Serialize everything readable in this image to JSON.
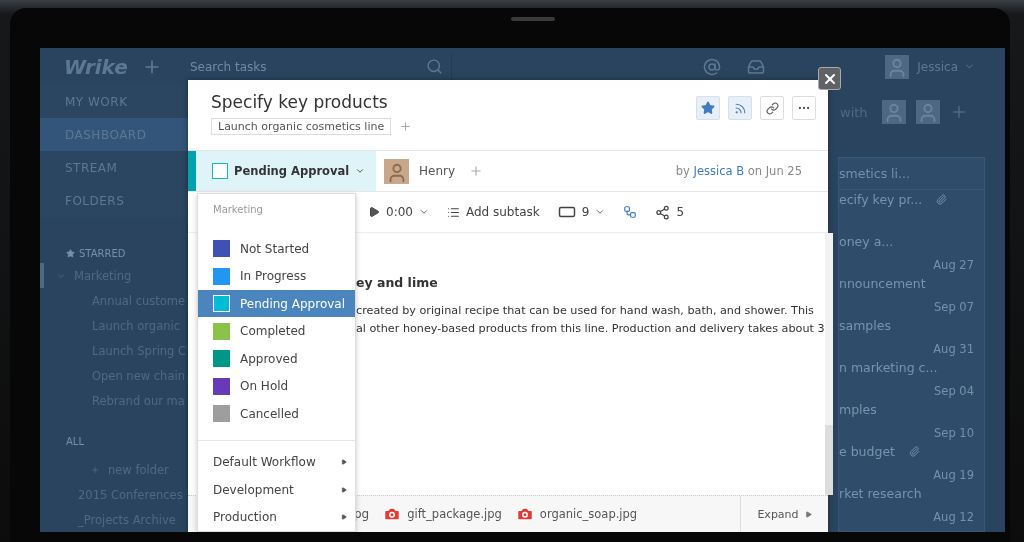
{
  "topbar": {
    "logo": "Wrike",
    "search": {
      "placeholder": "Search tasks"
    },
    "user": "Jessica"
  },
  "sidebar": {
    "nav": [
      {
        "label": "MY WORK",
        "selected": false
      },
      {
        "label": "DASHBOARD",
        "selected": true
      },
      {
        "label": "STREAM",
        "selected": false
      },
      {
        "label": "FOLDERS",
        "selected": false
      }
    ],
    "starred": {
      "label": "STARRED",
      "folder": {
        "label": "Marketing",
        "expanded": true,
        "children": [
          {
            "label": "Annual custome"
          },
          {
            "label": "Launch organic"
          },
          {
            "label": "Launch Spring C"
          },
          {
            "label": "Open new chain"
          },
          {
            "label": "Rebrand our ma"
          }
        ]
      }
    },
    "all": {
      "label": "ALL",
      "new_folder": "new folder",
      "folders": [
        "2015 Conferences",
        "_Projects Archive"
      ]
    }
  },
  "right_panel": {
    "shared_label": "with",
    "card_title": "smetics li...",
    "tasks": [
      {
        "title": "ecify key pr...",
        "attachment": true
      },
      {
        "title": "oney a...",
        "date": "Aug 27",
        "attachment": false
      },
      {
        "title": "nnouncement",
        "date": "Sep 07",
        "attachment": false
      },
      {
        "title": "samples",
        "date": "Aug 31",
        "attachment": false
      },
      {
        "title": "n marketing c...",
        "date": "Sep 04",
        "attachment": false
      },
      {
        "title": "mples",
        "date": "Sep 10",
        "attachment": false
      },
      {
        "title": "e budget",
        "date": "Aug 19",
        "attachment": true
      },
      {
        "title": "rket research",
        "date": "Aug 12",
        "attachment": false
      }
    ]
  },
  "task": {
    "title": "Specify key products",
    "folder_tag": "Launch organic cosmetics line",
    "actions": [
      {
        "kind": "star",
        "on": true
      },
      {
        "kind": "rss",
        "on": true
      },
      {
        "kind": "link",
        "on": false
      },
      {
        "kind": "more",
        "on": false
      }
    ],
    "status": {
      "label": "Pending Approval",
      "checked": false
    },
    "assignee": "Henry",
    "author_line": {
      "prefix": "by",
      "author": "Jessica B",
      "suffix": "on Jun 25"
    },
    "toolbar": {
      "timer": "0:00",
      "add_subtask": "Add subtask",
      "subtask_count": "9",
      "shares": "5"
    },
    "description": {
      "heading": "ey and lime",
      "lines": [
        "created by original recipe that can be used for hand wash, bath, and shower. This",
        "al other honey-based products from this line. Production and delivery takes about 3"
      ]
    },
    "attachments": {
      "partial": "pg",
      "files": [
        "gift_package.jpg",
        "organic_soap.jpg"
      ],
      "expand": "Expand"
    }
  },
  "status_menu": {
    "group": "Marketing",
    "statuses": [
      {
        "label": "Not Started",
        "color": "#3f51b5",
        "selected": false
      },
      {
        "label": "In Progress",
        "color": "#2196f3",
        "selected": false
      },
      {
        "label": "Pending Approval",
        "color": "#00bcd4",
        "selected": true
      },
      {
        "label": "Completed",
        "color": "#8bc34a",
        "selected": false
      },
      {
        "label": "Approved",
        "color": "#009688",
        "selected": false
      },
      {
        "label": "On Hold",
        "color": "#673ab7",
        "selected": false
      },
      {
        "label": "Cancelled",
        "color": "#9e9e9e",
        "selected": false
      }
    ],
    "workflows": [
      "Default Workflow",
      "Development",
      "Production"
    ]
  }
}
